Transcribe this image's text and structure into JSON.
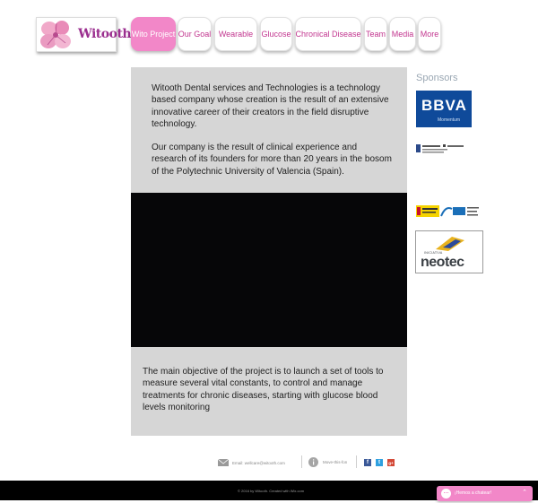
{
  "brand": {
    "name": "Witooth"
  },
  "nav": {
    "items": [
      {
        "label": "Wito Project",
        "active": true
      },
      {
        "label": "Our Goal",
        "active": false
      },
      {
        "label": "Wearable",
        "active": false
      },
      {
        "label": "Glucose",
        "active": false
      },
      {
        "label": "Chronical Disease",
        "active": false
      },
      {
        "label": "Team",
        "active": false
      },
      {
        "label": "Media",
        "active": false
      },
      {
        "label": "More",
        "active": false
      }
    ]
  },
  "main": {
    "intro_1": "Witooth Dental services and Technologies is a technology based company whose creation is the result of an extensive innovative career of their creators in the field disruptive technology.",
    "intro_2": "Our company is the result of clinical experience and research of its founders for more than 20 years in the bosom of the Polytechnic University of Valencia (Spain).",
    "objective": "The main objective of the project is to launch a set of tools to measure several vital constants, to control and manage treatments for chronic diseases, starting with glucose blood levels monitoring"
  },
  "sponsors": {
    "title": "Sponsors",
    "bbva": {
      "name": "BBVA",
      "sub": "Momentum"
    },
    "neotec": {
      "name": "neotec",
      "small": "INICIATIVA"
    }
  },
  "footer": {
    "email": "Email: wellcare@witooth.com",
    "phone": "Move-this-fon",
    "social": [
      "f",
      "t",
      "g+"
    ],
    "copyright": "© 2016 by Witooth. Created with Wix.com"
  },
  "chat": {
    "label": "¡Hemos a chatear!"
  },
  "colors": {
    "accent": "#f287c8",
    "brand_text": "#c2368f",
    "panel": "#d6d6d6",
    "sponsor_title": "#9aa7b3"
  }
}
